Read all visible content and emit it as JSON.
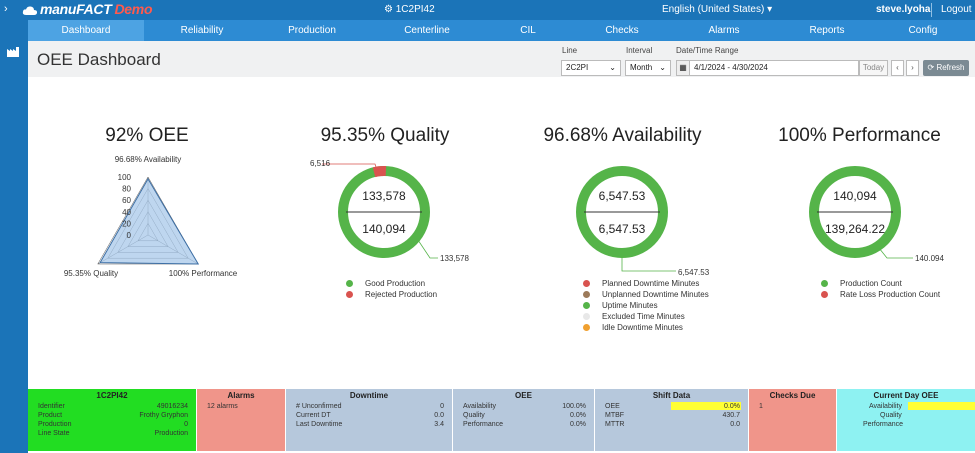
{
  "topbar": {
    "logo_text": "manuFACT",
    "logo_demo": "Demo",
    "center_label": "1C2PI42",
    "language": "English (United States)",
    "user": "steve.lyoha",
    "logout": "Logout"
  },
  "nav": {
    "tabs": [
      {
        "label": "Dashboard"
      },
      {
        "label": "Reliability"
      },
      {
        "label": "Production"
      },
      {
        "label": "Centerline"
      },
      {
        "label": "CIL"
      },
      {
        "label": "Checks"
      },
      {
        "label": "Alarms"
      },
      {
        "label": "Reports"
      },
      {
        "label": "Config"
      }
    ]
  },
  "header": {
    "title": "OEE Dashboard",
    "line_label": "Line",
    "line_value": "2C2PI",
    "interval_label": "Interval",
    "interval_value": "Month",
    "daterange_label": "Date/Time Range",
    "daterange_value": "4/1/2024 - 4/30/2024",
    "today": "Today",
    "refresh": "Refresh"
  },
  "oee": {
    "title": "92% OEE",
    "radar_top": "96.68% Availability",
    "radar_left": "95.35% Quality",
    "radar_right": "100% Performance",
    "ticks": [
      "100",
      "80",
      "60",
      "40",
      "20",
      "0"
    ]
  },
  "quality": {
    "title": "95.35% Quality",
    "top": "133,578",
    "bottom": "140,094",
    "label_small": "6,516",
    "label_main": "133,578",
    "legend": [
      {
        "label": "Good Production",
        "color": "#55b449"
      },
      {
        "label": "Rejected Production",
        "color": "#d9534f"
      }
    ]
  },
  "availability": {
    "title": "96.68% Availability",
    "top": "6,547.53",
    "bottom": "6,547.53",
    "label_main": "6,547.53",
    "legend": [
      {
        "label": "Planned Downtime Minutes",
        "color": "#d9534f"
      },
      {
        "label": "Unplanned Downtime Minutes",
        "color": "#9c7a5a"
      },
      {
        "label": "Uptime Minutes",
        "color": "#55b449"
      },
      {
        "label": "Excluded Time Minutes",
        "color": "#e8e8e8"
      },
      {
        "label": "Idle Downtime Minutes",
        "color": "#f0a030"
      }
    ]
  },
  "performance": {
    "title": "100% Performance",
    "top": "140,094",
    "bottom": "139,264.22",
    "label_main": "140.094",
    "legend": [
      {
        "label": "Production Count",
        "color": "#55b449"
      },
      {
        "label": "Rate Loss Production Count",
        "color": "#d9534f"
      }
    ]
  },
  "chart_data": [
    {
      "type": "radar",
      "title": "92% OEE",
      "axes": [
        "Availability",
        "Quality",
        "Performance"
      ],
      "values": [
        96.68,
        95.35,
        100
      ],
      "ylim": [
        0,
        100
      ]
    },
    {
      "type": "pie",
      "title": "95.35% Quality",
      "slices": [
        {
          "name": "Good Production",
          "value": 133578
        },
        {
          "name": "Rejected Production",
          "value": 6516
        }
      ]
    },
    {
      "type": "pie",
      "title": "96.68% Availability",
      "slices": [
        {
          "name": "Uptime Minutes",
          "value": 6547.53
        }
      ]
    },
    {
      "type": "pie",
      "title": "100% Performance",
      "slices": [
        {
          "name": "Production Count",
          "value": 140094
        }
      ]
    }
  ],
  "bottom": {
    "line": {
      "title": "1C2PI42",
      "rows": [
        {
          "k": "Identifier",
          "v": "49016234"
        },
        {
          "k": "Product",
          "v": "Frothy Gryphon"
        },
        {
          "k": "Production",
          "v": "0"
        },
        {
          "k": "Line State",
          "v": "Production"
        }
      ],
      "color": "#22dd22"
    },
    "alarms": {
      "title": "Alarms",
      "rows": [
        {
          "k": "12 alarms",
          "v": ""
        }
      ],
      "color": "#f0958a"
    },
    "downtime": {
      "title": "Downtime",
      "rows": [
        {
          "k": "# Unconfirmed",
          "v": "0"
        },
        {
          "k": "Current DT",
          "v": "0.0"
        },
        {
          "k": "Last Downtime",
          "v": "3.4"
        }
      ],
      "color": "#b6c8dc"
    },
    "oee": {
      "title": "OEE",
      "rows": [
        {
          "k": "Availability",
          "v": "100.0%"
        },
        {
          "k": "Quality",
          "v": "0.0%"
        },
        {
          "k": "Performance",
          "v": "0.0%"
        }
      ],
      "color": "#b6c8dc"
    },
    "shift": {
      "title": "Shift Data",
      "rows": [
        {
          "k": "OEE",
          "v": "0.0%"
        },
        {
          "k": "MTBF",
          "v": "430.7"
        },
        {
          "k": "MTTR",
          "v": "0.0"
        }
      ],
      "color": "#b6c8dc"
    },
    "checks": {
      "title": "Checks Due",
      "rows": [
        {
          "k": "1",
          "v": ""
        }
      ],
      "color": "#f0958a"
    },
    "current": {
      "title": "Current Day OEE",
      "rows": [
        {
          "k": "Availability",
          "v": ""
        },
        {
          "k": "Quality",
          "v": ""
        },
        {
          "k": "Performance",
          "v": ""
        }
      ],
      "color": "#8ef2f2"
    }
  }
}
